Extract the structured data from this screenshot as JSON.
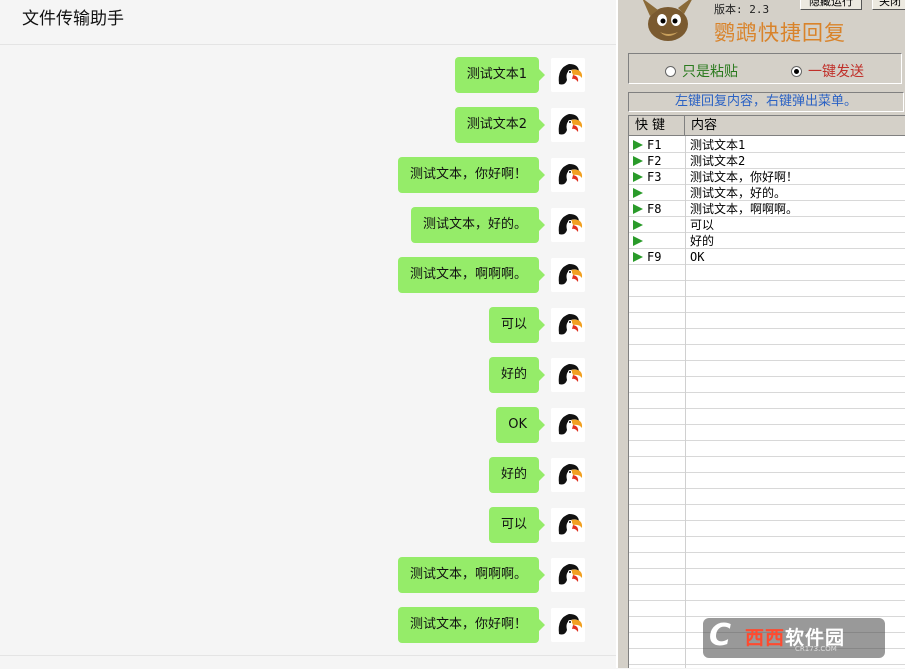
{
  "chat": {
    "title": "文件传输助手",
    "messages": [
      "测试文本1",
      "测试文本2",
      "测试文本，你好啊！",
      "测试文本，好的。",
      "测试文本，啊啊啊。",
      "可以",
      "好的",
      "OK",
      "好的",
      "可以",
      "测试文本，啊啊啊。",
      "测试文本，你好啊！"
    ],
    "bubble_color": "#95ec69"
  },
  "tool": {
    "version": "版本: 2.3",
    "hide_button": "隐藏运行",
    "close_button": "关闭",
    "title": "鹦鹉快捷回复",
    "radio_paste": "只是粘贴",
    "radio_send": "一键发送",
    "selected_mode": "一键发送",
    "hint": "左键回复内容，右键弹出菜单。",
    "col_key": "快键",
    "col_content": "内容",
    "rows": [
      {
        "key": "F1",
        "content": "测试文本1"
      },
      {
        "key": "F2",
        "content": "测试文本2"
      },
      {
        "key": "F3",
        "content": "测试文本，你好啊！"
      },
      {
        "key": "",
        "content": "测试文本，好的。"
      },
      {
        "key": "F8",
        "content": "测试文本，啊啊啊。"
      },
      {
        "key": "",
        "content": "可以"
      },
      {
        "key": "",
        "content": "好的"
      },
      {
        "key": "F9",
        "content": "OK"
      }
    ],
    "title_color": "#d9832a",
    "hint_color": "#2b62c4"
  },
  "watermark": {
    "brand_red": "西西",
    "brand_white": "软件园",
    "site": "CR173.COM"
  }
}
